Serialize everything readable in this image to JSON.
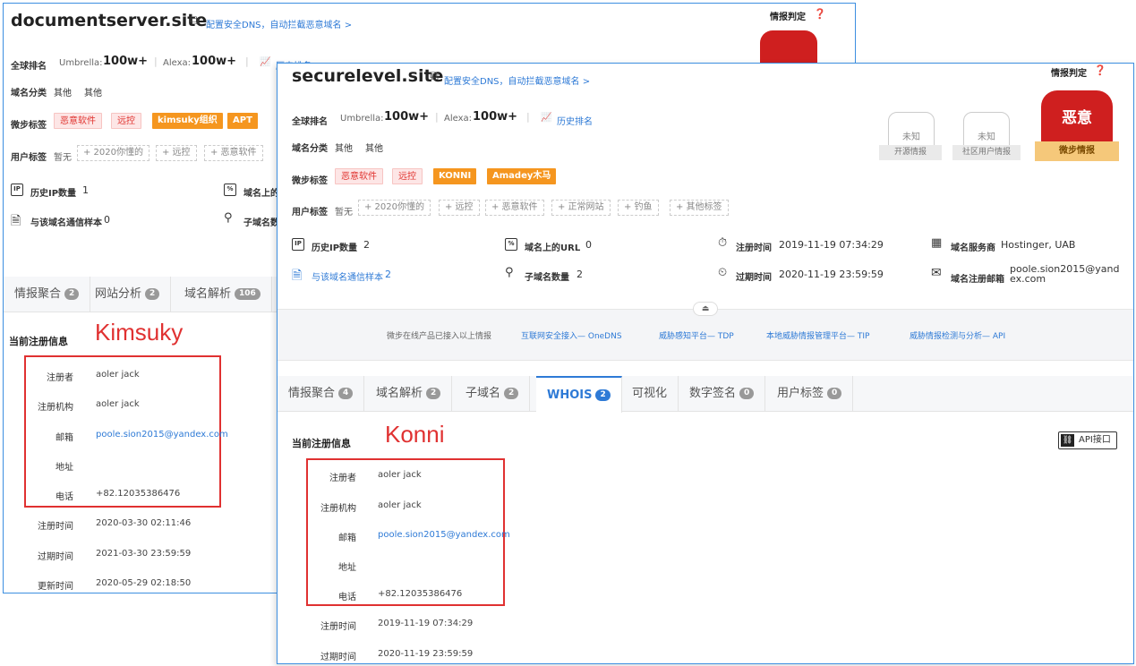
{
  "back": {
    "domain": "documentserver.site",
    "dns_link": "配置安全DNS，自动拦截恶意域名 >",
    "verdict_title": "情报判定",
    "rank_label": "全球排名",
    "umbrella_label": "Umbrella:",
    "umbrella_value": "100w+",
    "alexa_label": "Alexa:",
    "alexa_value": "100w+",
    "history_rank": "历史排名",
    "category_label": "域名分类",
    "category_values": [
      "其他",
      "其他"
    ],
    "micro_tag_label": "微步标签",
    "micro_tags": [
      "恶意软件",
      "远控",
      "kimsuky组织",
      "APT"
    ],
    "user_tag_label": "用户标签",
    "user_tag_none": "暂无",
    "user_tags": [
      "+ 2020你懂的",
      "+ 远控",
      "+ 恶意软件"
    ],
    "hist_ip_label": "历史IP数量",
    "hist_ip_value": "1",
    "url_label": "域名上的",
    "comm_samples_label": "与该域名通信样本",
    "comm_samples_value": "0",
    "subdomain_label": "子域名数",
    "tabs": [
      {
        "label": "情报聚合",
        "count": "2"
      },
      {
        "label": "网站分析",
        "count": "2"
      },
      {
        "label": "域名解析",
        "count": "106"
      }
    ],
    "section_title": "当前注册信息",
    "annotation": "Kimsuky",
    "whois": [
      {
        "key": "注册者",
        "value": "aoler jack"
      },
      {
        "key": "注册机构",
        "value": "aoler jack"
      },
      {
        "key": "邮箱",
        "value": "poole.sion2015@yandex.com"
      },
      {
        "key": "地址",
        "value": ""
      },
      {
        "key": "电话",
        "value": "+82.12035386476"
      },
      {
        "key": "注册时间",
        "value": "2020-03-30 02:11:46"
      },
      {
        "key": "过期时间",
        "value": "2021-03-30 23:59:59"
      },
      {
        "key": "更新时间",
        "value": "2020-05-29 02:18:50"
      }
    ]
  },
  "front": {
    "domain": "securelevel.site",
    "dns_link": "配置安全DNS，自动拦截恶意域名 >",
    "verdict_title": "情报判定",
    "verdict": {
      "open_source": {
        "status": "未知",
        "label": "开源情报"
      },
      "community": {
        "status": "未知",
        "label": "社区用户情报"
      },
      "threatbook": {
        "status": "恶意",
        "label": "微步情报"
      }
    },
    "rank_label": "全球排名",
    "umbrella_label": "Umbrella:",
    "umbrella_value": "100w+",
    "alexa_label": "Alexa:",
    "alexa_value": "100w+",
    "history_rank": "历史排名",
    "category_label": "域名分类",
    "category_values": [
      "其他",
      "其他"
    ],
    "micro_tag_label": "微步标签",
    "micro_tags": [
      "恶意软件",
      "远控",
      "KONNI",
      "Amadey木马"
    ],
    "user_tag_label": "用户标签",
    "user_tag_none": "暂无",
    "user_tags": [
      "+ 2020你懂的",
      "+ 远控",
      "+ 恶意软件",
      "+ 正常网站",
      "+ 钓鱼",
      "+ 其他标签"
    ],
    "stats": {
      "hist_ip_label": "历史IP数量",
      "hist_ip_value": "2",
      "url_label": "域名上的URL",
      "url_value": "0",
      "reg_time_label": "注册时间",
      "reg_time_value": "2019-11-19 07:34:29",
      "registrar_label": "域名服务商",
      "registrar_value": "Hostinger, UAB",
      "comm_samples_label": "与该域名通信样本",
      "comm_samples_value": "2",
      "subdomain_label": "子域名数量",
      "subdomain_value": "2",
      "exp_time_label": "过期时间",
      "exp_time_value": "2020-11-19 23:59:59",
      "email_label": "域名注册邮箱",
      "email_value_1": "poole.sion2015@yand",
      "email_value_2": "ex.com"
    },
    "promo": {
      "intro": "微步在线产品已接入以上情报",
      "links": [
        "互联网安全接入— OneDNS",
        "威胁感知平台— TDP",
        "本地威胁情报管理平台— TIP",
        "威胁情报检测与分析— API"
      ]
    },
    "tabs": [
      {
        "label": "情报聚合",
        "count": "4"
      },
      {
        "label": "域名解析",
        "count": "2"
      },
      {
        "label": "子域名",
        "count": "2"
      },
      {
        "label": "WHOIS",
        "count": "2"
      },
      {
        "label": "可视化",
        "count": ""
      },
      {
        "label": "数字签名",
        "count": "0"
      },
      {
        "label": "用户标签",
        "count": "0"
      }
    ],
    "section_title": "当前注册信息",
    "annotation": "Konni",
    "api_button": "API接口",
    "whois": [
      {
        "key": "注册者",
        "value": "aoler jack"
      },
      {
        "key": "注册机构",
        "value": "aoler jack"
      },
      {
        "key": "邮箱",
        "value": "poole.sion2015@yandex.com"
      },
      {
        "key": "地址",
        "value": ""
      },
      {
        "key": "电话",
        "value": "+82.12035386476"
      },
      {
        "key": "注册时间",
        "value": "2019-11-19 07:34:29"
      },
      {
        "key": "过期时间",
        "value": "2020-11-19 23:59:59"
      }
    ]
  },
  "colors": {
    "accent": "#2e7ad6",
    "malicious": "#cf1f1f",
    "annotation": "#e03131",
    "tag_orange": "#f5961f"
  }
}
